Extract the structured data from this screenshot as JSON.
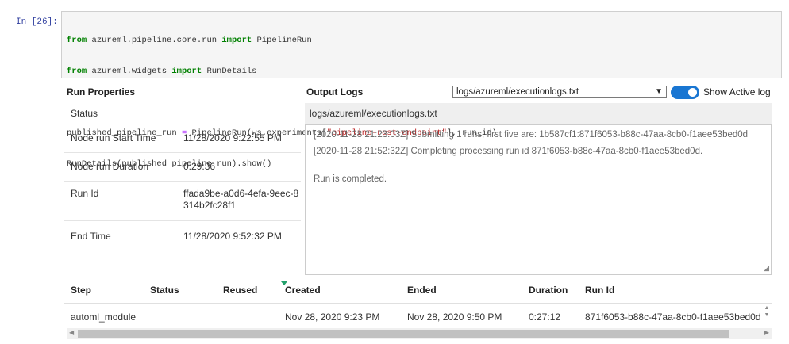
{
  "notebook": {
    "prompt": "In [26]:",
    "code": {
      "l1_kw1": "from",
      "l1_mod": " azureml.pipeline.core.run ",
      "l1_kw2": "import",
      "l1_name": " PipelineRun",
      "l2_kw1": "from",
      "l2_mod": " azureml.widgets ",
      "l2_kw2": "import",
      "l2_name": " RunDetails",
      "l3_a": "published_pipeline_run ",
      "l3_op": "=",
      "l3_b": " PipelineRun(ws.experiments[",
      "l3_str": "\"pipeline-rest-endpoint\"",
      "l3_c": "], run_id)",
      "l4": "RunDetails(published_pipeline_run).show()"
    }
  },
  "run_properties": {
    "title": "Run Properties",
    "rows": [
      {
        "key": "Status",
        "value": ""
      },
      {
        "key": "Node run Start Time",
        "value": "11/28/2020 9:22:55 PM"
      },
      {
        "key": "Node run Duration",
        "value": "0:29:36"
      },
      {
        "key": "Run Id",
        "value": "ffada9be-a0d6-4efa-9eec-8314b2fc28f1"
      },
      {
        "key": "End Time",
        "value": "11/28/2020 9:52:32 PM"
      }
    ]
  },
  "output_logs": {
    "title": "Output Logs",
    "selected_log": "logs/azureml/executionlogs.txt",
    "toggle_label": "Show Active log",
    "toggle_on": true,
    "header": "logs/azureml/executionlogs.txt",
    "lines": [
      "[2020-11-28 21:23:03Z] Submitting 1 runs, first five are: 1b587cf1:871f6053-b88c-47aa-8cb0-f1aee53bed0d",
      "[2020-11-28 21:52:32Z] Completing processing run id 871f6053-b88c-47aa-8cb0-f1aee53bed0d.",
      "Run is completed."
    ]
  },
  "steps_table": {
    "columns": [
      "Step",
      "Status",
      "Reused",
      "Created",
      "Ended",
      "Duration",
      "Run Id"
    ],
    "rows": [
      [
        "automl_module",
        "",
        "",
        "Nov 28, 2020 9:23 PM",
        "Nov 28, 2020 9:50 PM",
        "0:27:12",
        "871f6053-b88c-47aa-8cb0-f1aee53bed0d"
      ]
    ]
  },
  "colors": {
    "toggle": "#1976d2",
    "keyword": "#008000",
    "string": "#ba2121",
    "sort_indicator": "#22a06b"
  }
}
